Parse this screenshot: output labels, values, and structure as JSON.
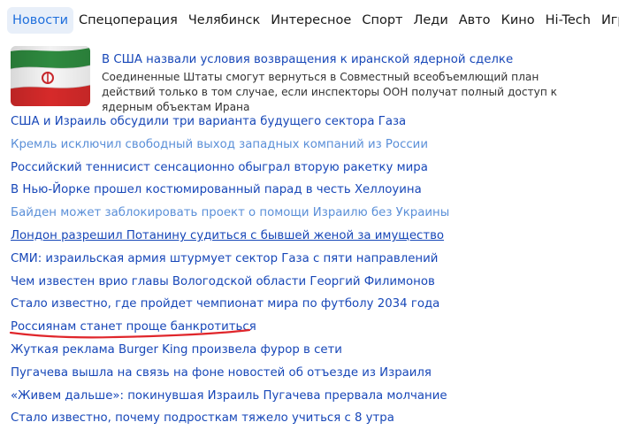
{
  "nav": {
    "tabs": [
      {
        "label": "Новости",
        "active": true
      },
      {
        "label": "Спецоперация"
      },
      {
        "label": "Челябинск"
      },
      {
        "label": "Интересное"
      },
      {
        "label": "Спорт"
      },
      {
        "label": "Леди"
      },
      {
        "label": "Авто"
      },
      {
        "label": "Кино"
      },
      {
        "label": "Hi-Tech"
      },
      {
        "label": "Игры"
      }
    ]
  },
  "lead": {
    "image_icon": "iran-flag",
    "title": "В США назвали условия возвращения к иранской ядерной сделке",
    "text": "Соединенные Штаты смогут вернуться в Совместный всеобъемлющий план действий только в том случае, если инспекторы ООН получат полный доступ к ядерным объектам Ирана"
  },
  "news": [
    {
      "title": "США и Израиль обсудили три варианта будущего сектора Газа"
    },
    {
      "title": "Кремль исключил свободный выход западных компаний из России",
      "visited": true
    },
    {
      "title": "Российский теннисист сенсационно обыграл вторую ракетку мира"
    },
    {
      "title": "В Нью-Йорке прошел костюмированный парад в честь Хеллоуина"
    },
    {
      "title": "Байден может заблокировать проект о помощи Израилю без Украины",
      "visited": true
    },
    {
      "title": "Лондон разрешил Потанину судиться с бывшей женой за имущество",
      "hover": true
    },
    {
      "title": "СМИ: израильская армия штурмует сектор Газа с пяти направлений"
    },
    {
      "title": "Чем известен врио главы Вологодской области Георгий Филимонов"
    },
    {
      "title": "Стало известно, где пройдет чемпионат мира по футболу 2034 года"
    },
    {
      "title": "Россиянам станет проще банкротиться",
      "annotated": true
    },
    {
      "title": "Жуткая реклама Burger King произвела фурор в сети"
    },
    {
      "title": "Пугачева вышла на связь на фоне новостей об отъезде из Израиля"
    },
    {
      "title": "«Живем дальше»: покинувшая Израиль Пугачева прервала молчание"
    },
    {
      "title": "Стало известно, почему подросткам тяжело учиться с 8 утра"
    }
  ],
  "colors": {
    "link": "#1747b8",
    "visited_link": "#5a8fd8",
    "active_tab_bg": "#e8eff9",
    "active_tab_text": "#1f6fdc",
    "annotation_stroke": "#e0262b"
  }
}
